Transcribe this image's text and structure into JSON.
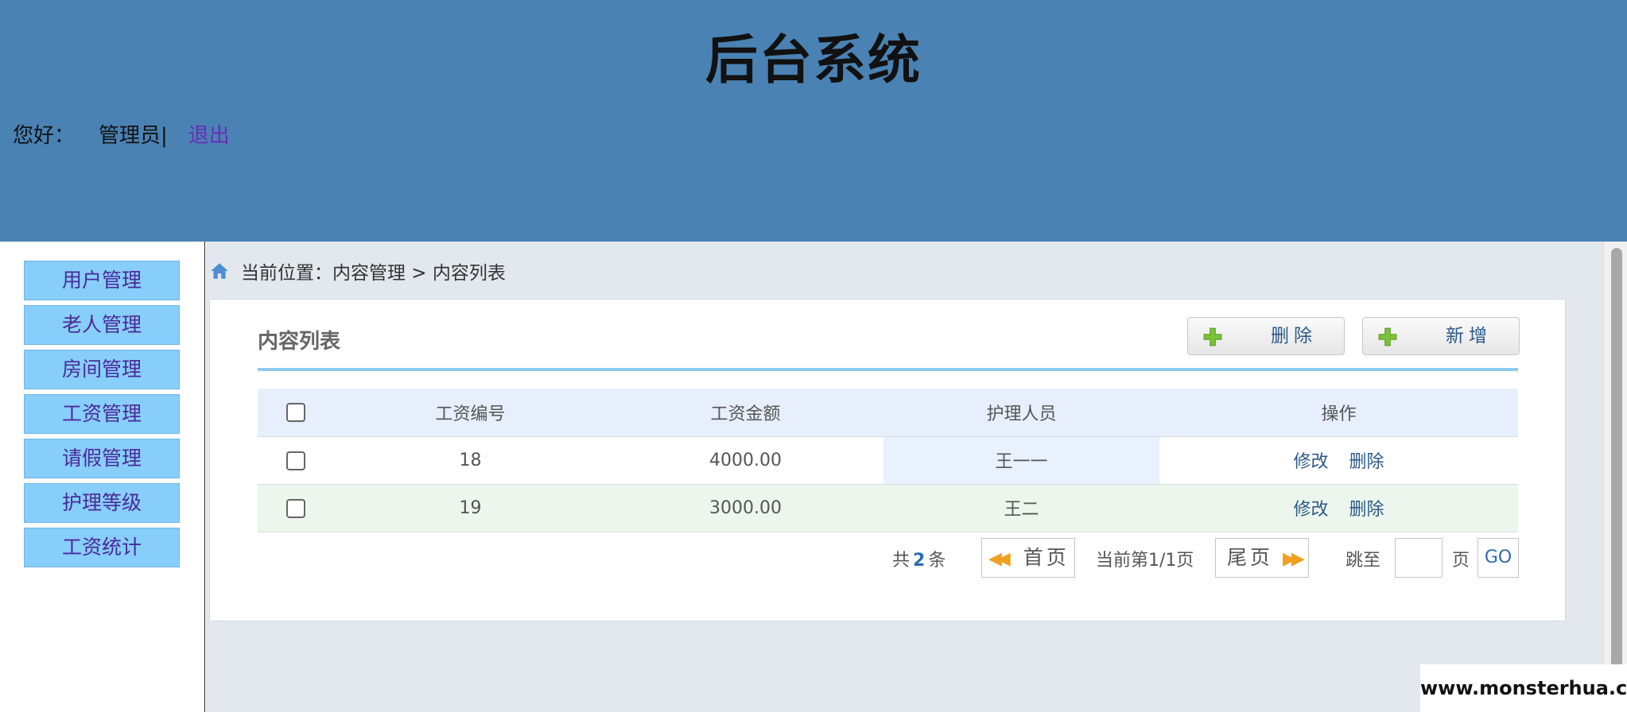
{
  "header": {
    "title": "后台系统",
    "greeting": "您好：",
    "username": "管理员|",
    "logout": "退出"
  },
  "sidebar": {
    "items": [
      {
        "label": "用户管理"
      },
      {
        "label": "老人管理"
      },
      {
        "label": "房间管理"
      },
      {
        "label": "工资管理"
      },
      {
        "label": "请假管理"
      },
      {
        "label": "护理等级"
      },
      {
        "label": "工资统计"
      }
    ]
  },
  "breadcrumb": {
    "text": "当前位置：内容管理 > 内容列表"
  },
  "panel": {
    "title": "内容列表",
    "delete_label": "删除",
    "add_label": "新增"
  },
  "table": {
    "headers": {
      "id": "工资编号",
      "amount": "工资金额",
      "nurse": "护理人员",
      "ops": "操作"
    },
    "rows": [
      {
        "id": "18",
        "amount": "4000.00",
        "nurse": "王一一",
        "edit": "修改",
        "delete": "删除"
      },
      {
        "id": "19",
        "amount": "3000.00",
        "nurse": "王二",
        "edit": "修改",
        "delete": "删除"
      }
    ]
  },
  "pagination": {
    "total_prefix": "共",
    "total_count": "2",
    "total_suffix": "条",
    "first_label": "首页",
    "current": "当前第1/1页",
    "last_label": "尾页",
    "jump_label": "跳至",
    "page_unit": "页",
    "go_label": "GO"
  },
  "watermark": "www.monsterhua.com",
  "colors": {
    "header_bg": "#4a82b3",
    "sidebar_item_bg": "#87cefa",
    "main_bg": "#e3e8ee",
    "accent_rule": "#8ecbf0",
    "link": "#2b5a8a"
  },
  "icons": [
    "home-icon",
    "plus-icon",
    "double-arrow-left-icon",
    "double-arrow-right-icon"
  ]
}
